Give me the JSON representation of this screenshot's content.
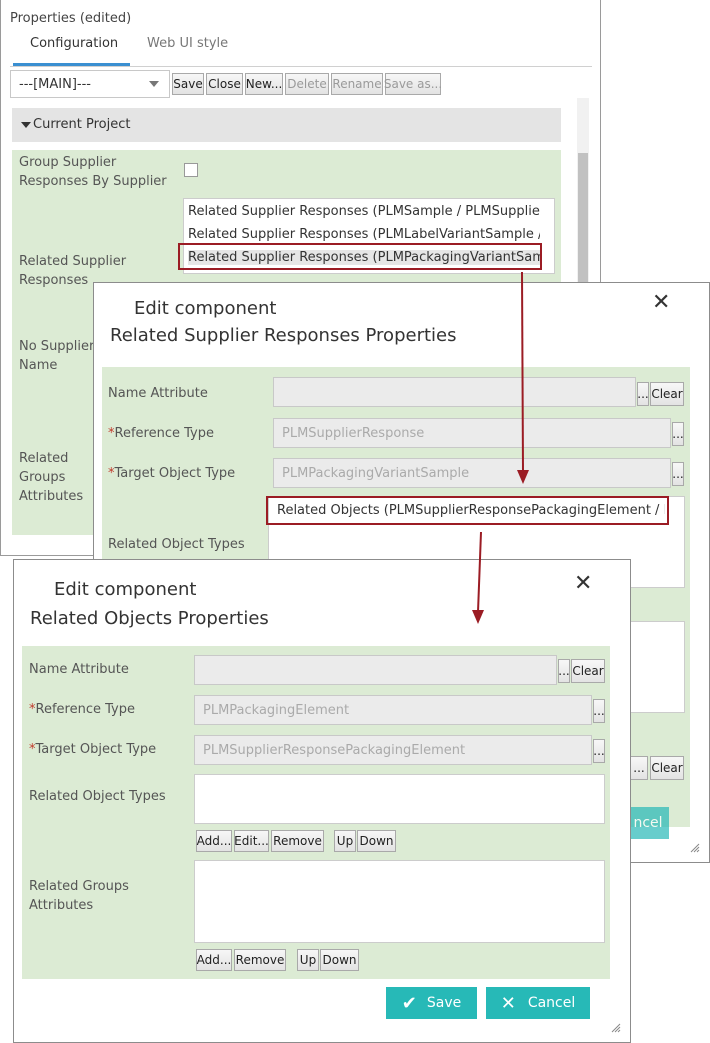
{
  "properties": {
    "title": "Properties (edited)",
    "tabs": [
      {
        "label": "Configuration",
        "active": true
      },
      {
        "label": "Web UI style",
        "active": false
      }
    ],
    "config_select": "---[MAIN]---",
    "toolbar": {
      "save": "Save",
      "close": "Close",
      "new": "New...",
      "delete": "Delete",
      "rename": "Rename",
      "save_as": "Save as..."
    },
    "section": "Current Project",
    "group_label": "Group Supplier Responses By Supplier",
    "related_label": "Related Supplier Responses",
    "related_items": [
      "Related Supplier Responses (PLMSample / PLMSuppliersResponse)",
      "Related Supplier Responses (PLMLabelVariantSample / PLMSupplierResponse)",
      "Related Supplier Responses (PLMPackagingVariantSample / PLMSupplierResponse)"
    ],
    "no_supplier_label": "No Supplier Name",
    "related_groups_label": "Related Groups Attributes"
  },
  "dialog1": {
    "title": "Edit component",
    "subtitle": "Related Supplier Responses Properties",
    "name_attr_label": "Name Attribute",
    "ref_type_label": "Reference Type",
    "ref_type_value": "PLMSupplierResponse",
    "target_label": "Target Object Type",
    "target_value": "PLMPackagingVariantSample",
    "related_obj_label": "Related Object Types",
    "related_obj_item": "Related Objects (PLMSupplierResponsePackagingElement / PLMPackagingElement)",
    "ellipsis": "...",
    "clear": "Clear",
    "cancel_partial": "ncel"
  },
  "dialog2": {
    "title": "Edit component",
    "subtitle": "Related Objects Properties",
    "name_attr_label": "Name Attribute",
    "ref_type_label": "Reference Type",
    "ref_type_value": "PLMPackagingElement",
    "target_label": "Target Object Type",
    "target_value": "PLMSupplierResponsePackagingElement",
    "related_obj_label": "Related Object Types",
    "related_groups_label": "Related Groups Attributes",
    "ellipsis": "...",
    "clear": "Clear",
    "add": "Add...",
    "edit": "Edit...",
    "remove": "Remove",
    "up": "Up",
    "down": "Down",
    "save": "Save",
    "cancel": "Cancel",
    "required_mark": "*"
  },
  "colors": {
    "accent": "#27b9b7",
    "highlight": "#9b1c24",
    "panel": "#dcebd4"
  }
}
